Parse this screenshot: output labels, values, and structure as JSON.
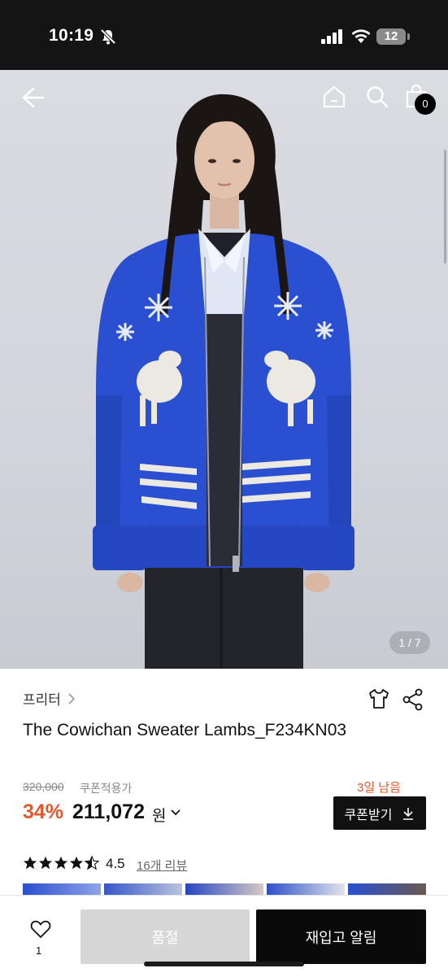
{
  "status_bar": {
    "time": "10:19",
    "battery": "12"
  },
  "gallery": {
    "counter": "1 / 7"
  },
  "header": {
    "cart_count": "0"
  },
  "product": {
    "brand": "프리터",
    "title": "The Cowichan Sweater Lambs_F234KN03",
    "original_price": "320,000",
    "coupon_note": "쿠폰적용가",
    "discount": "34%",
    "sale_price": "211,072",
    "currency": "원",
    "days_left": "3일 남음",
    "coupon_button": "쿠폰받기",
    "rating": "4.5",
    "rating_stars": 4.5,
    "reviews_link": "16개 리뷰"
  },
  "bottom_bar": {
    "like_count": "1",
    "soldout_label": "품절",
    "restock_label": "재입고 알림"
  },
  "colors": {
    "accent": "#e4572e",
    "sweater": "#2a4fd0",
    "button_dark": "#111111",
    "button_disabled": "#d6d6d6"
  }
}
